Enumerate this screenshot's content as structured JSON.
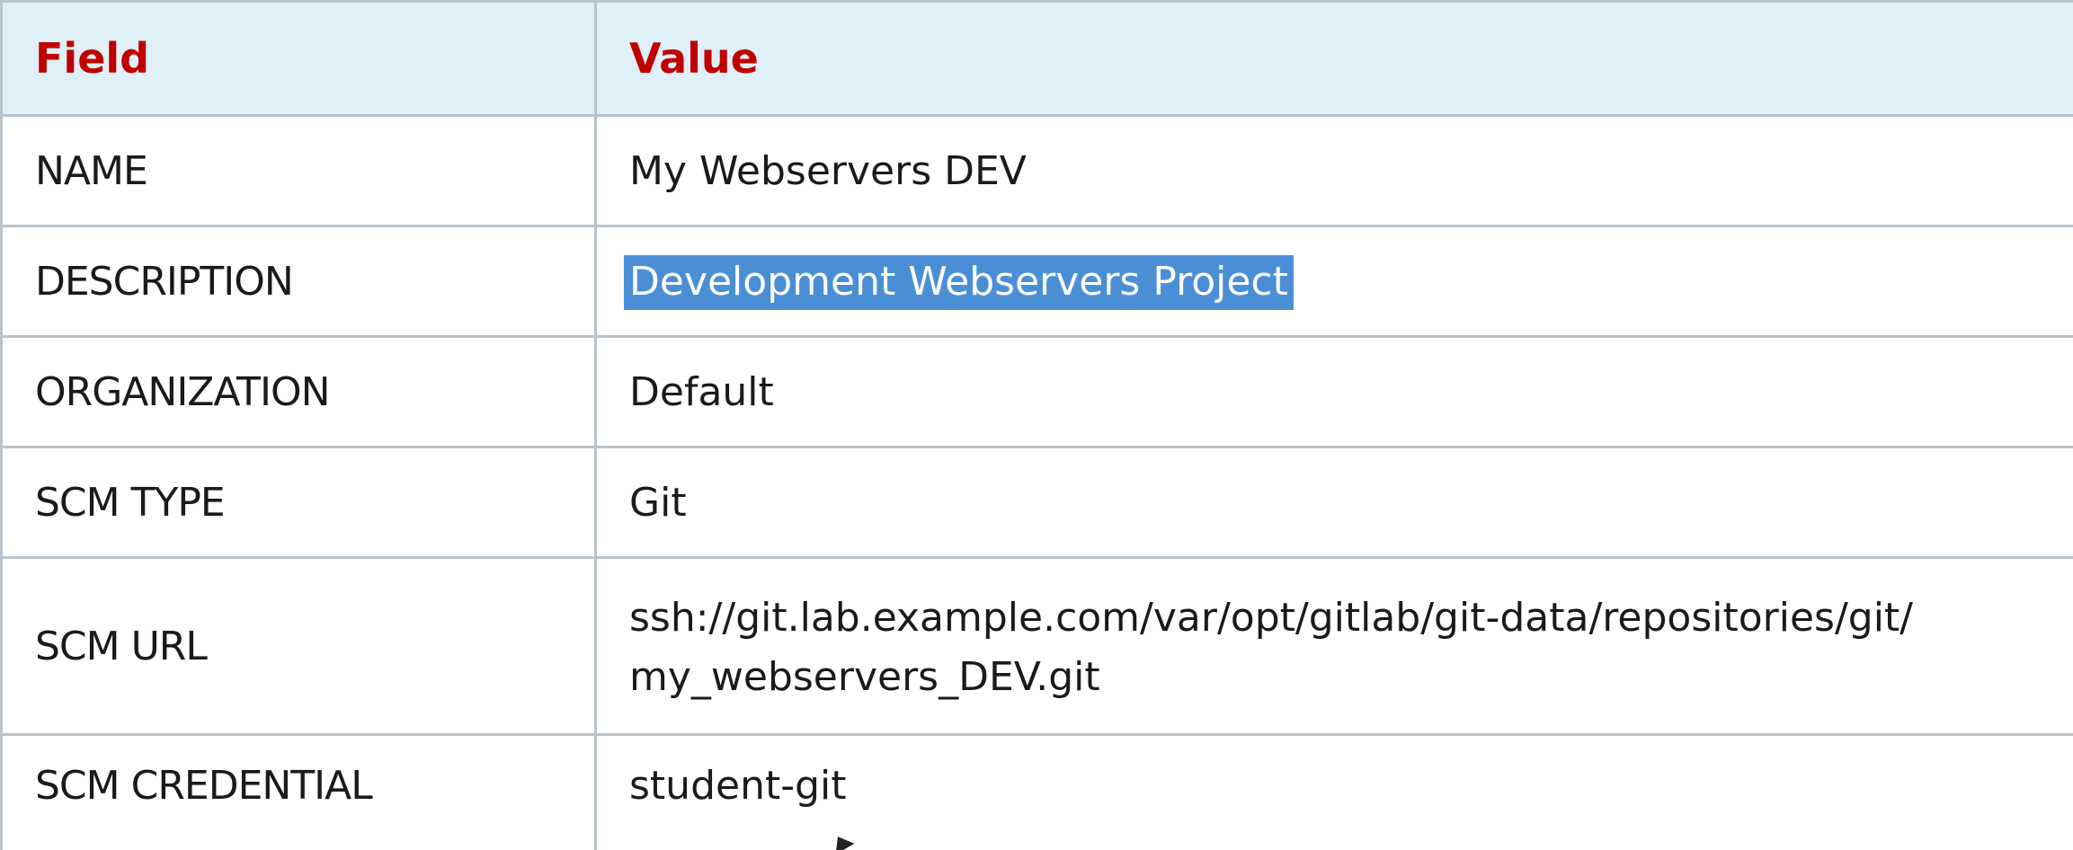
{
  "table": {
    "headers": {
      "field": "Field",
      "value": "Value"
    },
    "rows": [
      {
        "field": "NAME",
        "value": "My Webservers DEV"
      },
      {
        "field": "DESCRIPTION",
        "value": "Development Webservers Project",
        "selected": true
      },
      {
        "field": "ORGANIZATION",
        "value": "Default"
      },
      {
        "field": "SCM TYPE",
        "value": "Git"
      },
      {
        "field": "SCM URL",
        "value_lines": [
          "ssh://git.lab.example.com/var/opt/gitlab/git-data/repositories/git/",
          "my_webservers_DEV.git"
        ]
      },
      {
        "field": "SCM CREDENTIAL",
        "value": "student-git"
      }
    ]
  },
  "colors": {
    "header_bg": "#e0f0f8",
    "header_text": "#c00000",
    "border": "#b9c3cb",
    "selection": "#4a8fd6"
  },
  "icons": {
    "cursor": "mouse-pointer-icon"
  }
}
